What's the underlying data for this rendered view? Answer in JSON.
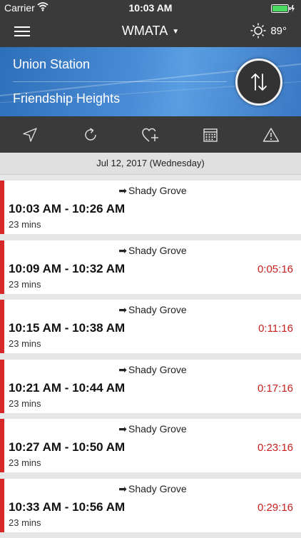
{
  "status_bar": {
    "carrier": "Carrier",
    "time": "10:03 AM"
  },
  "nav": {
    "title": "WMATA",
    "temperature": "89°",
    "icons": [
      "menu-icon",
      "sun-icon",
      "caret-down-icon"
    ]
  },
  "route": {
    "origin": "Union Station",
    "destination": "Friendship Heights",
    "banner_color": "#3f82cf"
  },
  "toolbar": {
    "items": [
      "location-arrow-icon",
      "refresh-icon",
      "favorite-add-icon",
      "calendar-icon",
      "alert-icon"
    ]
  },
  "date_header": "Jul 12, 2017 (Wednesday)",
  "trips": [
    {
      "direction": "Shady Grove",
      "times": "10:03 AM - 10:26 AM",
      "duration": "23 mins",
      "countdown": ""
    },
    {
      "direction": "Shady Grove",
      "times": "10:09 AM - 10:32 AM",
      "duration": "23 mins",
      "countdown": "0:05:16"
    },
    {
      "direction": "Shady Grove",
      "times": "10:15 AM - 10:38 AM",
      "duration": "23 mins",
      "countdown": "0:11:16"
    },
    {
      "direction": "Shady Grove",
      "times": "10:21 AM - 10:44 AM",
      "duration": "23 mins",
      "countdown": "0:17:16"
    },
    {
      "direction": "Shady Grove",
      "times": "10:27 AM - 10:50 AM",
      "duration": "23 mins",
      "countdown": "0:23:16"
    },
    {
      "direction": "Shady Grove",
      "times": "10:33 AM - 10:56 AM",
      "duration": "23 mins",
      "countdown": "0:29:16"
    }
  ],
  "colors": {
    "line_red": "#d62828",
    "countdown_red": "#c81e1e",
    "bar_dark": "#3a3a3a"
  }
}
